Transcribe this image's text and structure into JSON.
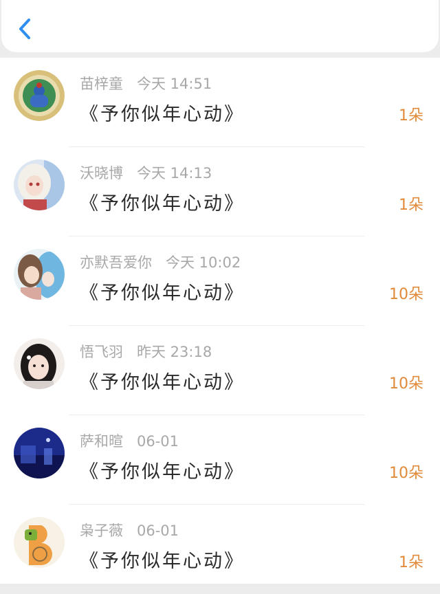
{
  "colors": {
    "accent": "#2e8ff0",
    "count": "#e08a3a",
    "meta": "#a8a8a8"
  },
  "header": {
    "back_icon": "chevron-left-icon"
  },
  "items": [
    {
      "name": "苗梓童",
      "time": "今天 14:51",
      "title": "《予你似年心动》",
      "count": "1朵"
    },
    {
      "name": "沃晓博",
      "time": "今天 14:13",
      "title": "《予你似年心动》",
      "count": "1朵"
    },
    {
      "name": "亦默吾爱你",
      "time": "今天 10:02",
      "title": "《予你似年心动》",
      "count": "10朵"
    },
    {
      "name": "悟飞羽",
      "time": "昨天 23:18",
      "title": "《予你似年心动》",
      "count": "10朵"
    },
    {
      "name": "萨和暄",
      "time": "06-01",
      "title": "《予你似年心动》",
      "count": "10朵"
    },
    {
      "name": "枭子薇",
      "time": "06-01",
      "title": "《予你似年心动》",
      "count": "1朵"
    }
  ]
}
